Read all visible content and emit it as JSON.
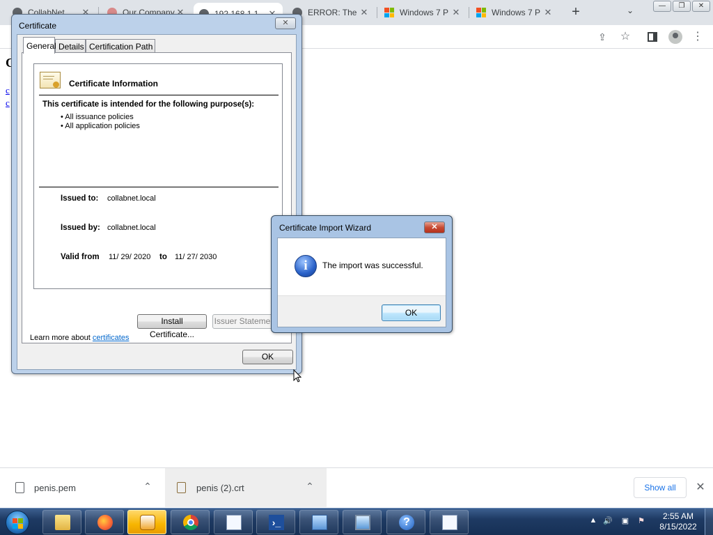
{
  "browser": {
    "tabs": [
      {
        "title": "CollabNet",
        "icon": "globe-icon"
      },
      {
        "title": "Our Company",
        "icon": "site-icon"
      },
      {
        "title": "192.168.1.1",
        "icon": "globe-icon"
      },
      {
        "title": "ERROR: The",
        "icon": "globe-icon"
      },
      {
        "title": "Windows 7 P",
        "icon": "windows-logo-icon"
      },
      {
        "title": "Windows 7 P",
        "icon": "windows-logo-icon"
      }
    ],
    "new_tab_label": "+",
    "window_controls": [
      "—",
      "❐",
      "✕"
    ]
  },
  "page": {
    "title_letter": "C",
    "links": [
      "c",
      "c"
    ]
  },
  "certificate_dialog": {
    "title": "Certificate",
    "tabs": [
      "General",
      "Details",
      "Certification Path"
    ],
    "header": "Certificate Information",
    "purpose_heading": "This certificate is intended for the following purpose(s):",
    "purposes": [
      "• All issuance policies",
      "• All application policies"
    ],
    "issued_to_label": "Issued to:",
    "issued_to": "collabnet.local",
    "issued_by_label": "Issued by:",
    "issued_by": "collabnet.local",
    "valid_from_label": "Valid from",
    "valid_from": "11/ 29/ 2020",
    "valid_to_label": "to",
    "valid_to": "11/ 27/ 2030",
    "install_button": "Install Certificate...",
    "issuer_button": "Issuer Statement",
    "learn_more": "Learn more about",
    "learn_more_link": "certificates",
    "ok_button": "OK"
  },
  "import_wizard": {
    "title": "Certificate Import Wizard",
    "message": "The import was successful.",
    "ok_button": "OK",
    "info_icon_glyph": "i"
  },
  "downloads": {
    "items": [
      {
        "name": "penis.pem"
      },
      {
        "name": "penis (2).crt"
      }
    ],
    "show_all": "Show all",
    "close": "✕"
  },
  "taskbar": {
    "time": "2:55 AM",
    "date": "8/15/2022"
  },
  "colors": {
    "link": "#1a73e8",
    "wizard_info_icon": "#2a62c9"
  }
}
